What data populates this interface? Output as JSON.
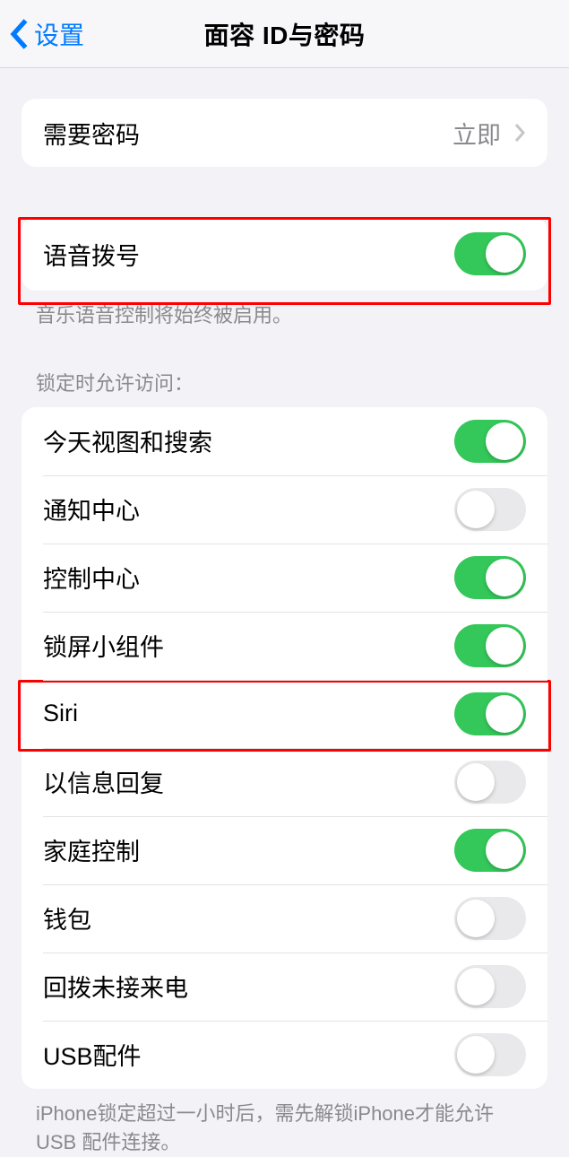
{
  "nav": {
    "back": "设置",
    "title": "面容 ID与密码"
  },
  "require_passcode": {
    "label": "需要密码",
    "value": "立即"
  },
  "voice_dial": {
    "label": "语音拨号",
    "enabled": true,
    "footer": "音乐语音控制将始终被启用。"
  },
  "locked_access": {
    "header": "锁定时允许访问：",
    "items": [
      {
        "label": "今天视图和搜索",
        "enabled": true
      },
      {
        "label": "通知中心",
        "enabled": false
      },
      {
        "label": "控制中心",
        "enabled": true
      },
      {
        "label": "锁屏小组件",
        "enabled": true
      },
      {
        "label": "Siri",
        "enabled": true
      },
      {
        "label": "以信息回复",
        "enabled": false
      },
      {
        "label": "家庭控制",
        "enabled": true
      },
      {
        "label": "钱包",
        "enabled": false
      },
      {
        "label": "回拨未接来电",
        "enabled": false
      },
      {
        "label": "USB配件",
        "enabled": false
      }
    ],
    "footer": "iPhone锁定超过一小时后，需先解锁iPhone才能允许USB 配件连接。"
  }
}
